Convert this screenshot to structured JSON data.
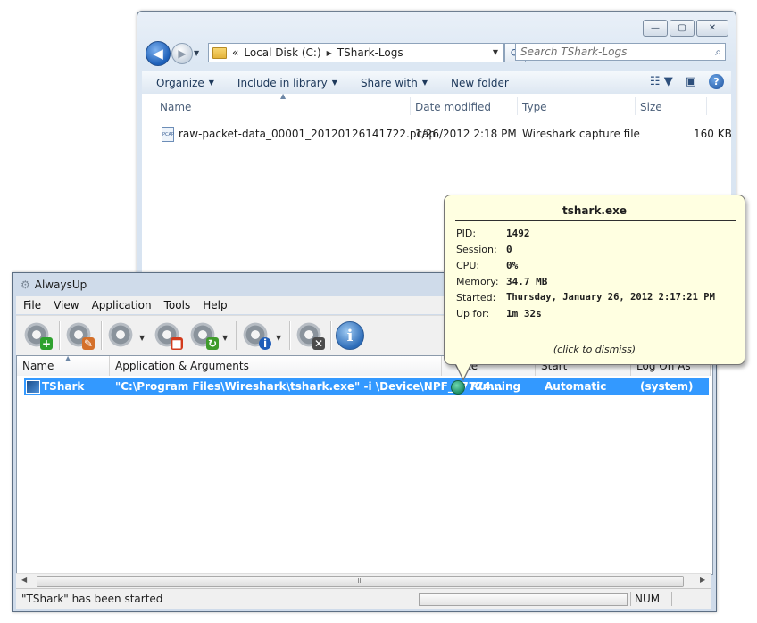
{
  "explorer": {
    "caption_buttons": {
      "minimize": "—",
      "maximize": "▢",
      "close": "✕"
    },
    "nav": {
      "back": "◀",
      "forward": "▶",
      "history": "▼"
    },
    "address": {
      "prefix": "«",
      "drive": "Local Disk (C:)",
      "separator": "▶",
      "folder": "TShark-Logs",
      "drop": "▼"
    },
    "refresh": "⟳",
    "search_placeholder": "Search TShark-Logs",
    "search_icon": "⌕",
    "commands": [
      {
        "label": "Organize",
        "arrow": "▼"
      },
      {
        "label": "Include in library",
        "arrow": "▼"
      },
      {
        "label": "Share with",
        "arrow": "▼"
      },
      {
        "label": "New folder",
        "arrow": ""
      }
    ],
    "view_icon": "☷ ▼",
    "preview_icon": "▣",
    "help_icon": "?",
    "columns": {
      "name": "Name",
      "date": "Date modified",
      "type": "Type",
      "size": "Size",
      "sort": "▲"
    },
    "files": [
      {
        "icon_label": "PCAP",
        "name": "raw-packet-data_00001_20120126141722.pcap",
        "date": "1/26/2012 2:18 PM",
        "type": "Wireshark capture file",
        "size": "160 KB"
      }
    ]
  },
  "alwaysup": {
    "title": "AlwaysUp",
    "title_icon": "⚙",
    "menu": [
      "File",
      "View",
      "Application",
      "Tools",
      "Help"
    ],
    "toolbar": {
      "add_badge": "+",
      "edit_badge": "✎",
      "stop_badge": "■",
      "restart_badge": "↻",
      "report_badge": "i",
      "delete_badge": "✕",
      "info_label": "i",
      "drop": "▼"
    },
    "list_headers": {
      "name": "Name",
      "app": "Application & Arguments",
      "state": "te",
      "start": "Start",
      "logon": "Log On As",
      "sort": "▲"
    },
    "rows": [
      {
        "name": "TShark",
        "app": "\"C:\\Program Files\\Wireshark\\tshark.exe\" -i \\Device\\NPF_{7774...",
        "state": "Running",
        "start": "Automatic",
        "logon": "(system)"
      }
    ],
    "scroll": {
      "left": "◀",
      "right": "▶",
      "grip": "III"
    },
    "status": {
      "message": "\"TShark\" has been started",
      "num": "NUM"
    }
  },
  "tooltip": {
    "title": "tshark.exe",
    "rows": [
      {
        "label": "PID:",
        "value": "1492"
      },
      {
        "label": "Session:",
        "value": "0"
      },
      {
        "label": "CPU:",
        "value": "0%"
      },
      {
        "label": "Memory:",
        "value": "34.7 MB"
      },
      {
        "label": "Started:",
        "value": "Thursday, January 26, 2012 2:17:21 PM"
      },
      {
        "label": "Up for:",
        "value": "1m 32s"
      }
    ],
    "dismiss": "(click to dismiss)"
  }
}
